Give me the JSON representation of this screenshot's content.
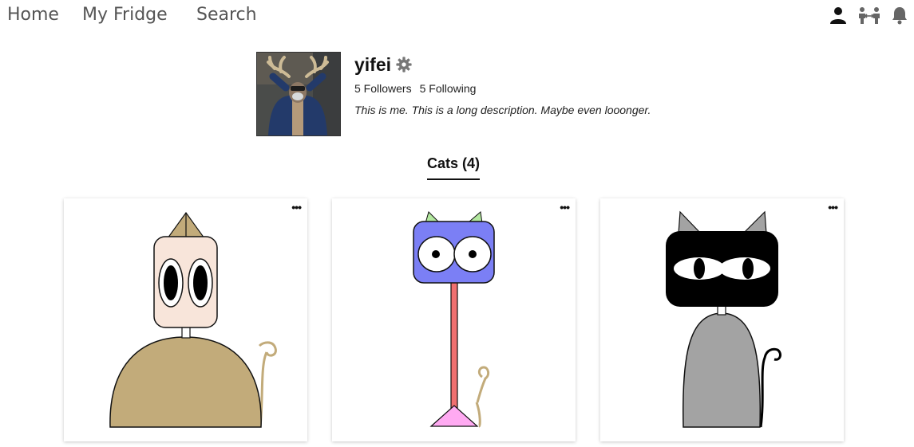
{
  "nav": {
    "home": "Home",
    "my_fridge": "My Fridge",
    "search": "Search",
    "icons": [
      "user-icon",
      "friends-icon",
      "bell-icon"
    ]
  },
  "profile": {
    "username": "yifei",
    "followers": "5 Followers",
    "following": "5 Following",
    "bio": "This is me. This is a long description. Maybe even looonger."
  },
  "tabs": {
    "cats": "Cats (4)"
  },
  "cards": [
    {
      "menu": "•••",
      "head_color": "#f8e5da",
      "hat_color": "#c2ab7a",
      "body_color": "#c2ab7a",
      "tail_color": "#c2ab7a"
    },
    {
      "menu": "•••",
      "head_color": "#7b7ff5",
      "ears_color": "#b3e89f",
      "neck_color": "#f07070",
      "body_color": "#ffaaf2",
      "tail_color": "#c2ab7a"
    },
    {
      "menu": "•••",
      "head_color": "#000000",
      "ears_color": "#a3a3a3",
      "body_color": "#a3a3a3",
      "tail_color": "#000000"
    }
  ]
}
